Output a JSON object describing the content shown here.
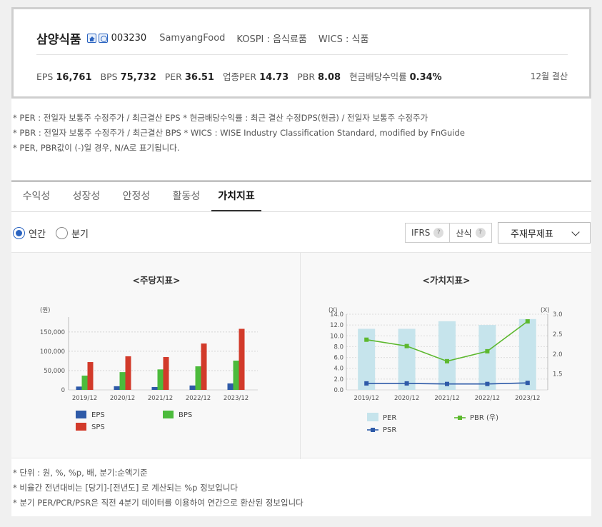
{
  "summary": {
    "company_name": "삼양식품",
    "code": "003230",
    "english_name": "SamyangFood",
    "market": "KOSPI : 음식료품",
    "wics": "WICS : 식품",
    "metrics": [
      {
        "label": "EPS",
        "value": "16,761"
      },
      {
        "label": "BPS",
        "value": "75,732"
      },
      {
        "label": "PER",
        "value": "36.51"
      },
      {
        "label": "업종PER",
        "value": "14.73"
      },
      {
        "label": "PBR",
        "value": "8.08"
      },
      {
        "label": "현금배당수익률",
        "value": "0.34%"
      }
    ],
    "settlement": "12월 결산"
  },
  "notes_top": [
    "* PER : 전일자 보통주 수정주가 / 최근결산 EPS * 현금배당수익률 : 최근 결산 수정DPS(현금) / 전일자 보통주 수정주가",
    "* PBR : 전일자 보통주 수정주가 / 최근결산 BPS * WICS : WISE Industry Classification Standard, modified by FnGuide",
    "* PER, PBR값이 (-)일 경우, N/A로 표기됩니다."
  ],
  "tabs": [
    "수익성",
    "성장성",
    "안정성",
    "활동성",
    "가치지표"
  ],
  "active_tab": "가치지표",
  "period": {
    "annual": "연간",
    "quarter": "분기",
    "selected": "annual"
  },
  "buttons": {
    "ifrs": "IFRS",
    "calc": "산식",
    "help": "?"
  },
  "statement_select": "주재무제표",
  "notes_bottom": [
    "* 단위 : 원, %, %p, 배, 분기:순액기준",
    "* 비율간 전년대비는 [당기]-[전년도] 로 계산되는 %p 정보입니다",
    "* 분기 PER/PCR/PSR은 직전 4분기 데이터를 이용하여 연간으로 환산된 정보입니다"
  ],
  "chart_data": [
    {
      "type": "bar",
      "title": "<주당지표>",
      "ylabel": "(원)",
      "categories": [
        "2019/12",
        "2020/12",
        "2021/12",
        "2022/12",
        "2023/12"
      ],
      "ylim": [
        0,
        170000
      ],
      "yticks": [
        0,
        50000,
        100000,
        150000
      ],
      "ytick_labels": [
        "0",
        "50,000",
        "100,000",
        "150,000"
      ],
      "series": [
        {
          "name": "EPS",
          "color": "#2e5aa8",
          "values": [
            8600,
            9500,
            7500,
            11400,
            16761
          ]
        },
        {
          "name": "BPS",
          "color": "#4cbb3c",
          "values": [
            37000,
            46000,
            53000,
            61000,
            75732
          ]
        },
        {
          "name": "SPS",
          "color": "#d23a2a",
          "values": [
            72000,
            87000,
            85000,
            120000,
            158000
          ]
        }
      ],
      "legend": "bottom"
    },
    {
      "type": "bar+line",
      "title": "<가치지표>",
      "categories": [
        "2019/12",
        "2020/12",
        "2021/12",
        "2022/12",
        "2023/12"
      ],
      "y_left": {
        "label": "(X)",
        "ylim": [
          0,
          14.0
        ],
        "ticks": [
          "0.0",
          "2.0",
          "4.0",
          "6.0",
          "8.0",
          "10.0",
          "12.0",
          "14.0"
        ]
      },
      "y_right": {
        "label": "(X)",
        "ylim": [
          1.1,
          3.0
        ],
        "ticks": [
          "1.5",
          "2.0",
          "2.5",
          "3.0"
        ]
      },
      "series": [
        {
          "name": "PER",
          "type": "bar",
          "axis": "left",
          "color": "#c6e4ec",
          "values": [
            11.3,
            11.3,
            12.7,
            12.0,
            13.1
          ]
        },
        {
          "name": "PBR (우)",
          "type": "line",
          "axis": "right",
          "color": "#5cb82e",
          "values": [
            2.36,
            2.2,
            1.82,
            2.07,
            2.82
          ]
        },
        {
          "name": "PSR",
          "type": "line",
          "axis": "left",
          "color": "#2e5aa8",
          "values": [
            1.2,
            1.2,
            1.1,
            1.1,
            1.3
          ]
        }
      ],
      "legend": "bottom"
    }
  ]
}
